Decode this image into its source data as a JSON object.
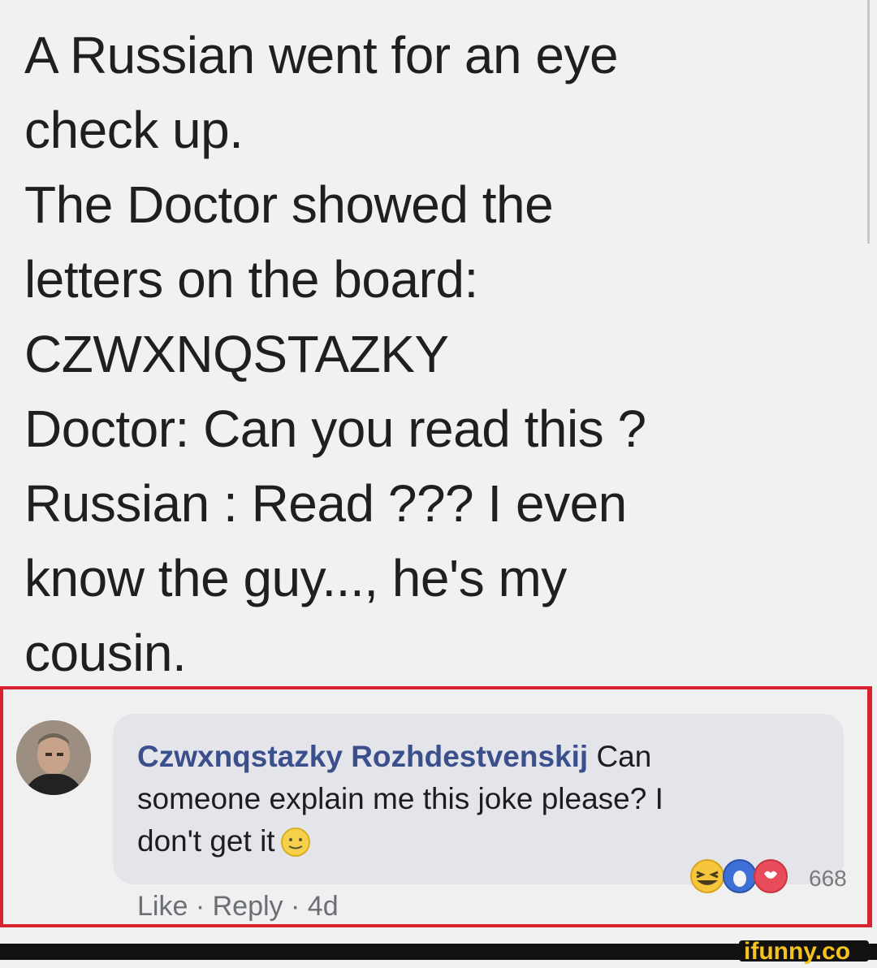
{
  "joke": {
    "lines": [
      "A Russian went for an eye",
      "check up.",
      "The Doctor showed the",
      "letters on the board:",
      "CZWXNQSTAZKY",
      "Doctor: Can you read this ?",
      "Russian : Read ??? I even",
      "know the guy..., he's my",
      "cousin."
    ]
  },
  "comment": {
    "author": "Czwxnqstazky Rozhdestvenskij",
    "text_line1": "Can",
    "text_line2": "someone explain me this joke please? I",
    "text_line3": "don't get it",
    "actions": {
      "like": "Like",
      "separator": "·",
      "reply": "Reply",
      "time": "4d"
    },
    "reactions": {
      "icons": [
        "laughing-emoji",
        "wow-emoji",
        "love-emoji"
      ],
      "count": "668"
    }
  },
  "colors": {
    "highlight_border": "#d6232d",
    "author_name": "#3b4f8c",
    "bubble": "#e4e5ea"
  },
  "watermark": {
    "logo_text": "ifunny.co"
  }
}
